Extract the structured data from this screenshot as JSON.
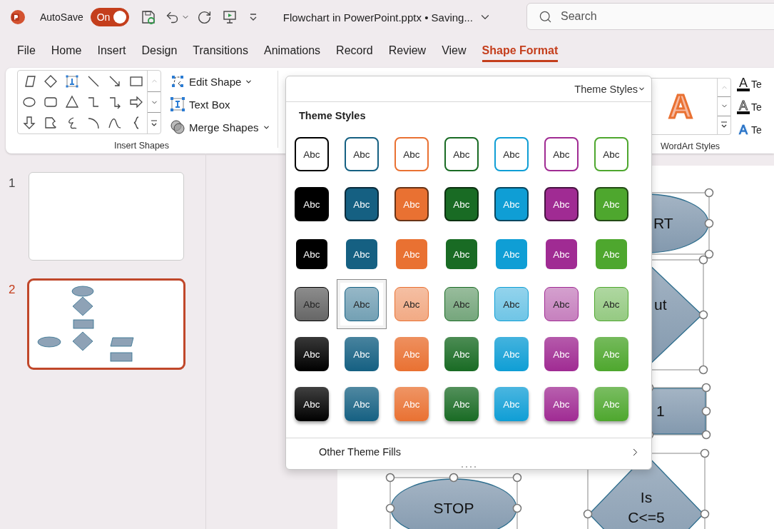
{
  "title_bar": {
    "autosave_label": "AutoSave",
    "autosave": {
      "label": "On",
      "on": true
    },
    "document_title": "Flowchart in PowerPoint.pptx • Saving...",
    "search": {
      "placeholder": "Search"
    }
  },
  "ribbon_tabs": [
    {
      "label": "File",
      "selected": false
    },
    {
      "label": "Home",
      "selected": false
    },
    {
      "label": "Insert",
      "selected": false
    },
    {
      "label": "Design",
      "selected": false
    },
    {
      "label": "Transitions",
      "selected": false
    },
    {
      "label": "Animations",
      "selected": false
    },
    {
      "label": "Record",
      "selected": false
    },
    {
      "label": "Review",
      "selected": false
    },
    {
      "label": "View",
      "selected": false
    },
    {
      "label": "Shape Format",
      "selected": true
    }
  ],
  "ribbon": {
    "insert_shapes": {
      "label": "Insert Shapes",
      "buttons": [
        {
          "kind": "edit_shape",
          "label": "Edit Shape",
          "menu": true
        },
        {
          "kind": "text_box",
          "label": "Text Box",
          "menu": false
        },
        {
          "kind": "merge_shapes",
          "label": "Merge Shapes",
          "menu": true
        }
      ]
    },
    "wordart_styles": {
      "label": "WordArt Styles",
      "sample": "A",
      "text_buttons": [
        {
          "kind": "fill",
          "glyph": "A",
          "label": "Te"
        },
        {
          "kind": "outline",
          "glyph": "A",
          "label": "Te"
        },
        {
          "kind": "effects",
          "glyph": "A",
          "label": "Te"
        }
      ]
    }
  },
  "slides": [
    {
      "number": "1",
      "kind": "blank",
      "selected": false
    },
    {
      "number": "2",
      "kind": "flowchart",
      "selected": true
    }
  ],
  "theme_styles_menu": {
    "header": "Theme Styles",
    "heading": "Theme Styles",
    "footer_item": "Other Theme Fills",
    "rows": [
      {
        "kind": "outline",
        "items": [
          {
            "label": "Abc",
            "color": "#000000",
            "selected": false
          },
          {
            "label": "Abc",
            "color": "#156082",
            "selected": false
          },
          {
            "label": "Abc",
            "color": "#e97132",
            "selected": false
          },
          {
            "label": "Abc",
            "color": "#196b24",
            "selected": false
          },
          {
            "label": "Abc",
            "color": "#0f9ed5",
            "selected": false
          },
          {
            "label": "Abc",
            "color": "#a02b93",
            "selected": false
          },
          {
            "label": "Abc",
            "color": "#4ea72e",
            "selected": false
          }
        ]
      },
      {
        "kind": "filled",
        "items": [
          {
            "label": "Abc",
            "color": "#000000",
            "selected": false
          },
          {
            "label": "Abc",
            "color": "#156082",
            "selected": false
          },
          {
            "label": "Abc",
            "color": "#e97132",
            "selected": false
          },
          {
            "label": "Abc",
            "color": "#196b24",
            "selected": false
          },
          {
            "label": "Abc",
            "color": "#0f9ed5",
            "selected": false
          },
          {
            "label": "Abc",
            "color": "#a02b93",
            "selected": false
          },
          {
            "label": "Abc",
            "color": "#4ea72e",
            "selected": false
          }
        ]
      },
      {
        "kind": "plain",
        "items": [
          {
            "label": "Abc",
            "color": "#000000",
            "selected": false
          },
          {
            "label": "Abc",
            "color": "#156082",
            "selected": false
          },
          {
            "label": "Abc",
            "color": "#e97132",
            "selected": false
          },
          {
            "label": "Abc",
            "color": "#196b24",
            "selected": false
          },
          {
            "label": "Abc",
            "color": "#0f9ed5",
            "selected": false
          },
          {
            "label": "Abc",
            "color": "#a02b93",
            "selected": false
          },
          {
            "label": "Abc",
            "color": "#4ea72e",
            "selected": false
          }
        ]
      },
      {
        "kind": "subtle",
        "items": [
          {
            "label": "Abc",
            "color": "#000000",
            "selected": false
          },
          {
            "label": "Abc",
            "color": "#156082",
            "selected": true
          },
          {
            "label": "Abc",
            "color": "#e97132",
            "selected": false
          },
          {
            "label": "Abc",
            "color": "#196b24",
            "selected": false
          },
          {
            "label": "Abc",
            "color": "#0f9ed5",
            "selected": false
          },
          {
            "label": "Abc",
            "color": "#a02b93",
            "selected": false
          },
          {
            "label": "Abc",
            "color": "#4ea72e",
            "selected": false
          }
        ]
      },
      {
        "kind": "moderate",
        "items": [
          {
            "label": "Abc",
            "color": "#000000",
            "selected": false
          },
          {
            "label": "Abc",
            "color": "#156082",
            "selected": false
          },
          {
            "label": "Abc",
            "color": "#e97132",
            "selected": false
          },
          {
            "label": "Abc",
            "color": "#196b24",
            "selected": false
          },
          {
            "label": "Abc",
            "color": "#0f9ed5",
            "selected": false
          },
          {
            "label": "Abc",
            "color": "#a02b93",
            "selected": false
          },
          {
            "label": "Abc",
            "color": "#4ea72e",
            "selected": false
          }
        ]
      },
      {
        "kind": "intense",
        "items": [
          {
            "label": "Abc",
            "color": "#000000",
            "selected": false
          },
          {
            "label": "Abc",
            "color": "#156082",
            "selected": false
          },
          {
            "label": "Abc",
            "color": "#e97132",
            "selected": false
          },
          {
            "label": "Abc",
            "color": "#196b24",
            "selected": false
          },
          {
            "label": "Abc",
            "color": "#0f9ed5",
            "selected": false
          },
          {
            "label": "Abc",
            "color": "#a02b93",
            "selected": false
          },
          {
            "label": "Abc",
            "color": "#4ea72e",
            "selected": false
          }
        ]
      }
    ]
  },
  "canvas": {
    "shapes": [
      {
        "kind": "ellipse",
        "text": "RT",
        "selected": true
      },
      {
        "kind": "diamond",
        "text": "ut",
        "selected": true
      },
      {
        "kind": "rectangle",
        "text": "1",
        "selected": true
      },
      {
        "kind": "ellipse",
        "text": "STOP",
        "selected": true
      },
      {
        "kind": "diamond",
        "text": "Is C<=5",
        "selected": true
      }
    ]
  }
}
